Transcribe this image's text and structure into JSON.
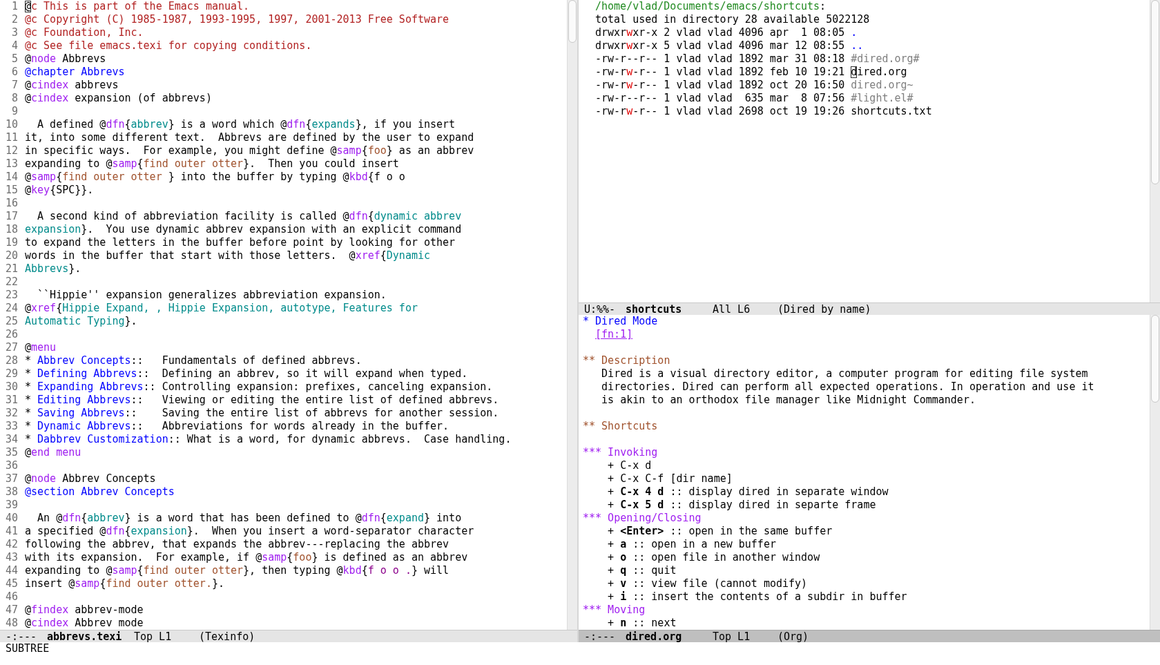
{
  "left": {
    "lines": [
      {
        "n": "1",
        "segs": [
          {
            "kind": "cur",
            "text": "@"
          },
          {
            "kind": "com",
            "text": "c This is part of the Emacs manual."
          }
        ]
      },
      {
        "n": "2",
        "segs": [
          {
            "kind": "com",
            "text": "@c Copyright (C) 1985-1987, 1993-1995, 1997, 2001-2013 Free Software"
          }
        ]
      },
      {
        "n": "3",
        "segs": [
          {
            "kind": "com",
            "text": "@c Foundation, Inc."
          }
        ]
      },
      {
        "n": "4",
        "segs": [
          {
            "kind": "com",
            "text": "@c See file emacs.texi for copying conditions."
          }
        ]
      },
      {
        "n": "5",
        "segs": [
          {
            "kind": "p",
            "text": "@"
          },
          {
            "kind": "kw",
            "text": "node"
          },
          {
            "kind": "p",
            "text": " Abbrevs"
          }
        ]
      },
      {
        "n": "6",
        "segs": [
          {
            "kind": "hd",
            "text": "@chapter Abbrevs"
          }
        ]
      },
      {
        "n": "7",
        "segs": [
          {
            "kind": "p",
            "text": "@"
          },
          {
            "kind": "kw",
            "text": "cindex"
          },
          {
            "kind": "p",
            "text": " abbrevs"
          }
        ]
      },
      {
        "n": "8",
        "segs": [
          {
            "kind": "p",
            "text": "@"
          },
          {
            "kind": "kw",
            "text": "cindex"
          },
          {
            "kind": "p",
            "text": " expansion (of abbrevs)"
          }
        ]
      },
      {
        "n": "9"
      },
      {
        "n": "10",
        "segs": [
          {
            "kind": "p",
            "text": "  A defined @"
          },
          {
            "kind": "kw",
            "text": "dfn"
          },
          {
            "kind": "p",
            "text": "{"
          },
          {
            "kind": "arg",
            "text": "abbrev"
          },
          {
            "kind": "p",
            "text": "} is a word which @"
          },
          {
            "kind": "kw",
            "text": "dfn"
          },
          {
            "kind": "p",
            "text": "{"
          },
          {
            "kind": "arg",
            "text": "expands"
          },
          {
            "kind": "p",
            "text": "}, if you insert"
          }
        ]
      },
      {
        "n": "11",
        "segs": [
          {
            "kind": "p",
            "text": "it, into some different text.  Abbrevs are defined by the user to expand"
          }
        ]
      },
      {
        "n": "12",
        "segs": [
          {
            "kind": "p",
            "text": "in specific ways.  For example, you might define @"
          },
          {
            "kind": "kw",
            "text": "samp"
          },
          {
            "kind": "p",
            "text": "{"
          },
          {
            "kind": "samp",
            "text": "foo"
          },
          {
            "kind": "p",
            "text": "} as an abbrev"
          }
        ]
      },
      {
        "n": "13",
        "segs": [
          {
            "kind": "p",
            "text": "expanding to @"
          },
          {
            "kind": "kw",
            "text": "samp"
          },
          {
            "kind": "p",
            "text": "{"
          },
          {
            "kind": "samp",
            "text": "find outer otter"
          },
          {
            "kind": "p",
            "text": "}.  Then you could insert"
          }
        ]
      },
      {
        "n": "14",
        "segs": [
          {
            "kind": "p",
            "text": "@"
          },
          {
            "kind": "kw",
            "text": "samp"
          },
          {
            "kind": "p",
            "text": "{"
          },
          {
            "kind": "samp",
            "text": "find outer otter "
          },
          {
            "kind": "p",
            "text": "} into the buffer by typing @"
          },
          {
            "kind": "kw",
            "text": "kbd"
          },
          {
            "kind": "p",
            "text": "{f o o"
          }
        ]
      },
      {
        "n": "15",
        "segs": [
          {
            "kind": "p",
            "text": "@"
          },
          {
            "kind": "kw",
            "text": "key"
          },
          {
            "kind": "p",
            "text": "{SPC}}."
          }
        ]
      },
      {
        "n": "16"
      },
      {
        "n": "17",
        "segs": [
          {
            "kind": "p",
            "text": "  A second kind of abbreviation facility is called @"
          },
          {
            "kind": "kw",
            "text": "dfn"
          },
          {
            "kind": "p",
            "text": "{"
          },
          {
            "kind": "arg",
            "text": "dynamic abbrev"
          }
        ]
      },
      {
        "n": "18",
        "segs": [
          {
            "kind": "arg",
            "text": "expansion"
          },
          {
            "kind": "p",
            "text": "}.  You use dynamic abbrev expansion with an explicit command"
          }
        ]
      },
      {
        "n": "19",
        "segs": [
          {
            "kind": "p",
            "text": "to expand the letters in the buffer before point by looking for other"
          }
        ]
      },
      {
        "n": "20",
        "segs": [
          {
            "kind": "p",
            "text": "words in the buffer that start with those letters.  @"
          },
          {
            "kind": "kw",
            "text": "xref"
          },
          {
            "kind": "p",
            "text": "{"
          },
          {
            "kind": "arg",
            "text": "Dynamic"
          }
        ]
      },
      {
        "n": "21",
        "segs": [
          {
            "kind": "arg",
            "text": "Abbrevs"
          },
          {
            "kind": "p",
            "text": "}."
          }
        ]
      },
      {
        "n": "22"
      },
      {
        "n": "23",
        "segs": [
          {
            "kind": "p",
            "text": "  ``Hippie'' expansion generalizes abbreviation expansion."
          }
        ]
      },
      {
        "n": "24",
        "segs": [
          {
            "kind": "p",
            "text": "@"
          },
          {
            "kind": "kw",
            "text": "xref"
          },
          {
            "kind": "p",
            "text": "{"
          },
          {
            "kind": "arg",
            "text": "Hippie Expand, , Hippie Expansion, autotype, Features for"
          }
        ]
      },
      {
        "n": "25",
        "segs": [
          {
            "kind": "arg",
            "text": "Automatic Typing"
          },
          {
            "kind": "p",
            "text": "}."
          }
        ]
      },
      {
        "n": "26"
      },
      {
        "n": "27",
        "segs": [
          {
            "kind": "p",
            "text": "@"
          },
          {
            "kind": "kw",
            "text": "menu"
          }
        ]
      },
      {
        "n": "28",
        "segs": [
          {
            "kind": "p",
            "text": "* "
          },
          {
            "kind": "hd",
            "text": "Abbrev Concepts"
          },
          {
            "kind": "p",
            "text": "::   Fundamentals of defined abbrevs."
          }
        ]
      },
      {
        "n": "29",
        "segs": [
          {
            "kind": "p",
            "text": "* "
          },
          {
            "kind": "hd",
            "text": "Defining Abbrevs"
          },
          {
            "kind": "p",
            "text": "::  Defining an abbrev, so it will expand when typed."
          }
        ]
      },
      {
        "n": "30",
        "segs": [
          {
            "kind": "p",
            "text": "* "
          },
          {
            "kind": "hd",
            "text": "Expanding Abbrevs"
          },
          {
            "kind": "p",
            "text": ":: Controlling expansion: prefixes, canceling expansion."
          }
        ]
      },
      {
        "n": "31",
        "segs": [
          {
            "kind": "p",
            "text": "* "
          },
          {
            "kind": "hd",
            "text": "Editing Abbrevs"
          },
          {
            "kind": "p",
            "text": "::   Viewing or editing the entire list of defined abbrevs."
          }
        ]
      },
      {
        "n": "32",
        "segs": [
          {
            "kind": "p",
            "text": "* "
          },
          {
            "kind": "hd",
            "text": "Saving Abbrevs"
          },
          {
            "kind": "p",
            "text": "::    Saving the entire list of abbrevs for another session."
          }
        ]
      },
      {
        "n": "33",
        "segs": [
          {
            "kind": "p",
            "text": "* "
          },
          {
            "kind": "hd",
            "text": "Dynamic Abbrevs"
          },
          {
            "kind": "p",
            "text": "::   Abbreviations for words already in the buffer."
          }
        ]
      },
      {
        "n": "34",
        "segs": [
          {
            "kind": "p",
            "text": "* "
          },
          {
            "kind": "hd",
            "text": "Dabbrev Customization"
          },
          {
            "kind": "p",
            "text": ":: What is a word, for dynamic abbrevs.  Case handling."
          }
        ]
      },
      {
        "n": "35",
        "segs": [
          {
            "kind": "p",
            "text": "@"
          },
          {
            "kind": "kw",
            "text": "end menu"
          }
        ]
      },
      {
        "n": "36"
      },
      {
        "n": "37",
        "segs": [
          {
            "kind": "p",
            "text": "@"
          },
          {
            "kind": "kw",
            "text": "node"
          },
          {
            "kind": "p",
            "text": " Abbrev Concepts"
          }
        ]
      },
      {
        "n": "38",
        "segs": [
          {
            "kind": "hd",
            "text": "@section Abbrev Concepts"
          }
        ]
      },
      {
        "n": "39"
      },
      {
        "n": "40",
        "segs": [
          {
            "kind": "p",
            "text": "  An @"
          },
          {
            "kind": "kw",
            "text": "dfn"
          },
          {
            "kind": "p",
            "text": "{"
          },
          {
            "kind": "arg",
            "text": "abbrev"
          },
          {
            "kind": "p",
            "text": "} is a word that has been defined to @"
          },
          {
            "kind": "kw",
            "text": "dfn"
          },
          {
            "kind": "p",
            "text": "{"
          },
          {
            "kind": "arg",
            "text": "expand"
          },
          {
            "kind": "p",
            "text": "} into"
          }
        ]
      },
      {
        "n": "41",
        "segs": [
          {
            "kind": "p",
            "text": "a specified @"
          },
          {
            "kind": "kw",
            "text": "dfn"
          },
          {
            "kind": "p",
            "text": "{"
          },
          {
            "kind": "arg",
            "text": "expansion"
          },
          {
            "kind": "p",
            "text": "}.  When you insert a word-separator character"
          }
        ]
      },
      {
        "n": "42",
        "segs": [
          {
            "kind": "p",
            "text": "following the abbrev, that expands the abbrev---replacing the abbrev"
          }
        ]
      },
      {
        "n": "43",
        "segs": [
          {
            "kind": "p",
            "text": "with its expansion.  For example, if @"
          },
          {
            "kind": "kw",
            "text": "samp"
          },
          {
            "kind": "p",
            "text": "{"
          },
          {
            "kind": "samp",
            "text": "foo"
          },
          {
            "kind": "p",
            "text": "} is defined as an abbrev"
          }
        ]
      },
      {
        "n": "44",
        "segs": [
          {
            "kind": "p",
            "text": "expanding to @"
          },
          {
            "kind": "kw",
            "text": "samp"
          },
          {
            "kind": "p",
            "text": "{"
          },
          {
            "kind": "samp",
            "text": "find outer otter"
          },
          {
            "kind": "p",
            "text": "}, then typing @"
          },
          {
            "kind": "kw",
            "text": "kbd"
          },
          {
            "kind": "p",
            "text": "{"
          },
          {
            "kind": "kbd",
            "text": "f o o ."
          },
          {
            "kind": "p",
            "text": "} will"
          }
        ]
      },
      {
        "n": "45",
        "segs": [
          {
            "kind": "p",
            "text": "insert @"
          },
          {
            "kind": "kw",
            "text": "samp"
          },
          {
            "kind": "p",
            "text": "{"
          },
          {
            "kind": "samp",
            "text": "find outer otter."
          },
          {
            "kind": "p",
            "text": "}."
          }
        ]
      },
      {
        "n": "46"
      },
      {
        "n": "47",
        "segs": [
          {
            "kind": "p",
            "text": "@"
          },
          {
            "kind": "kw",
            "text": "findex"
          },
          {
            "kind": "p",
            "text": " abbrev-mode"
          }
        ]
      },
      {
        "n": "48",
        "segs": [
          {
            "kind": "p",
            "text": "@"
          },
          {
            "kind": "kw",
            "text": "cindex"
          },
          {
            "kind": "p",
            "text": " Abbrev mode"
          }
        ]
      }
    ],
    "mode_line": {
      "status": "-:---",
      "buffer": "abbrevs.texi",
      "position": "Top L1",
      "mode": "(Texinfo)",
      "active": false
    }
  },
  "dired": {
    "lines": [
      {
        "segs": [
          {
            "kind": "dir",
            "text": "/home/vlad/Documents/emacs/shortcuts"
          },
          {
            "kind": "p",
            "text": ":"
          }
        ]
      },
      {
        "segs": [
          {
            "kind": "p",
            "text": "total used in directory 28 available 5022128"
          }
        ]
      },
      {
        "segs": [
          {
            "kind": "p",
            "text": "drwxr"
          },
          {
            "kind": "perm",
            "text": "w"
          },
          {
            "kind": "p",
            "text": "xr-x 2 vlad vlad 4096 apr  1 08:05 "
          },
          {
            "kind": "dot",
            "text": "."
          }
        ]
      },
      {
        "segs": [
          {
            "kind": "p",
            "text": "drwxr"
          },
          {
            "kind": "perm",
            "text": "w"
          },
          {
            "kind": "p",
            "text": "xr-x 5 vlad vlad 4096 mar 12 08:55 "
          },
          {
            "kind": "dot",
            "text": ".."
          }
        ]
      },
      {
        "segs": [
          {
            "kind": "p",
            "text": "-rw-r--r-- 1 vlad vlad 1892 mar 31 08:18 "
          },
          {
            "kind": "dim",
            "text": "#dired.org#"
          }
        ]
      },
      {
        "segs": [
          {
            "kind": "p",
            "text": "-rw-r"
          },
          {
            "kind": "perm",
            "text": "w"
          },
          {
            "kind": "p",
            "text": "-r-- 1 vlad vlad 1892 feb 10 19:21 "
          },
          {
            "kind": "cur",
            "text": "d"
          },
          {
            "kind": "p",
            "text": "ired.org"
          }
        ]
      },
      {
        "segs": [
          {
            "kind": "p",
            "text": "-rw-r"
          },
          {
            "kind": "perm",
            "text": "w"
          },
          {
            "kind": "p",
            "text": "-r-- 1 vlad vlad 1892 oct 20 16:50 "
          },
          {
            "kind": "dim",
            "text": "dired.org~"
          }
        ]
      },
      {
        "segs": [
          {
            "kind": "p",
            "text": "-rw-r--r-- 1 vlad vlad  635 mar  8 07:56 "
          },
          {
            "kind": "dim",
            "text": "#light.el#"
          }
        ]
      },
      {
        "segs": [
          {
            "kind": "p",
            "text": "-rw-r"
          },
          {
            "kind": "perm",
            "text": "w"
          },
          {
            "kind": "p",
            "text": "-r-- 1 vlad vlad 2698 oct 19 19:26 shortcuts.txt"
          }
        ]
      }
    ],
    "mode_line": {
      "status": "U:%%-",
      "buffer": "shortcuts",
      "position": "All L6",
      "mode": "(Dired by name)",
      "active": false
    }
  },
  "org": {
    "blocks": [
      [
        {
          "segs": [
            {
              "kind": "h1",
              "text": "* Dired Mode"
            }
          ]
        },
        {
          "segs": [
            {
              "kind": "link",
              "text": "[fn:1]"
            }
          ]
        }
      ],
      [
        {
          "segs": [
            {
              "kind": "h2",
              "text": "** Description"
            }
          ]
        },
        {
          "segs": [
            {
              "kind": "p",
              "text": "   Dired is a visual directory editor, a computer program for editing file system"
            }
          ]
        },
        {
          "segs": [
            {
              "kind": "p",
              "text": "   directories. Dired can perform all expected operations. In operation and use it"
            }
          ]
        },
        {
          "segs": [
            {
              "kind": "p",
              "text": "   is akin to an orthodox file manager like Midnight Commander."
            }
          ]
        }
      ],
      [
        {
          "segs": [
            {
              "kind": "h2",
              "text": "** Shortcuts"
            }
          ]
        }
      ],
      [
        {
          "segs": [
            {
              "kind": "h3",
              "text": "*** Invoking"
            }
          ]
        },
        {
          "segs": [
            {
              "kind": "p",
              "text": "    + C-x d"
            }
          ]
        },
        {
          "segs": [
            {
              "kind": "p",
              "text": "    + C-x C-f [dir name]"
            }
          ]
        },
        {
          "segs": [
            {
              "kind": "p",
              "text": "    + "
            },
            {
              "kind": "b",
              "text": "C-x 4 d"
            },
            {
              "kind": "p",
              "text": " :: display dired in separate window"
            }
          ]
        },
        {
          "segs": [
            {
              "kind": "p",
              "text": "    + "
            },
            {
              "kind": "b",
              "text": "C-x 5 d"
            },
            {
              "kind": "p",
              "text": " :: display dired in separte frame"
            }
          ]
        },
        {
          "segs": [
            {
              "kind": "h3",
              "text": "*** Opening/Closing"
            }
          ]
        },
        {
          "segs": [
            {
              "kind": "p",
              "text": "    + "
            },
            {
              "kind": "b",
              "text": "<Enter>"
            },
            {
              "kind": "p",
              "text": " :: open in the same buffer"
            }
          ]
        },
        {
          "segs": [
            {
              "kind": "p",
              "text": "    + "
            },
            {
              "kind": "b",
              "text": "a"
            },
            {
              "kind": "p",
              "text": " :: open in a new buffer"
            }
          ]
        },
        {
          "segs": [
            {
              "kind": "p",
              "text": "    + "
            },
            {
              "kind": "b",
              "text": "o"
            },
            {
              "kind": "p",
              "text": " :: open file in another window"
            }
          ]
        },
        {
          "segs": [
            {
              "kind": "p",
              "text": "    + "
            },
            {
              "kind": "b",
              "text": "q"
            },
            {
              "kind": "p",
              "text": " :: quit"
            }
          ]
        },
        {
          "segs": [
            {
              "kind": "p",
              "text": "    + "
            },
            {
              "kind": "b",
              "text": "v"
            },
            {
              "kind": "p",
              "text": " :: view file (cannot modify)"
            }
          ]
        },
        {
          "segs": [
            {
              "kind": "p",
              "text": "    + "
            },
            {
              "kind": "b",
              "text": "i"
            },
            {
              "kind": "p",
              "text": " :: insert the contents of a subdir in buffer"
            }
          ]
        },
        {
          "segs": [
            {
              "kind": "h3",
              "text": "*** Moving"
            }
          ]
        },
        {
          "segs": [
            {
              "kind": "p",
              "text": "    + "
            },
            {
              "kind": "b",
              "text": "n"
            },
            {
              "kind": "p",
              "text": " :: next"
            }
          ]
        }
      ]
    ],
    "mode_line": {
      "status": "-:---",
      "buffer": "dired.org",
      "position": "Top L1",
      "mode": "(Org)",
      "active": true
    }
  },
  "minibuffer": "SUBTREE"
}
